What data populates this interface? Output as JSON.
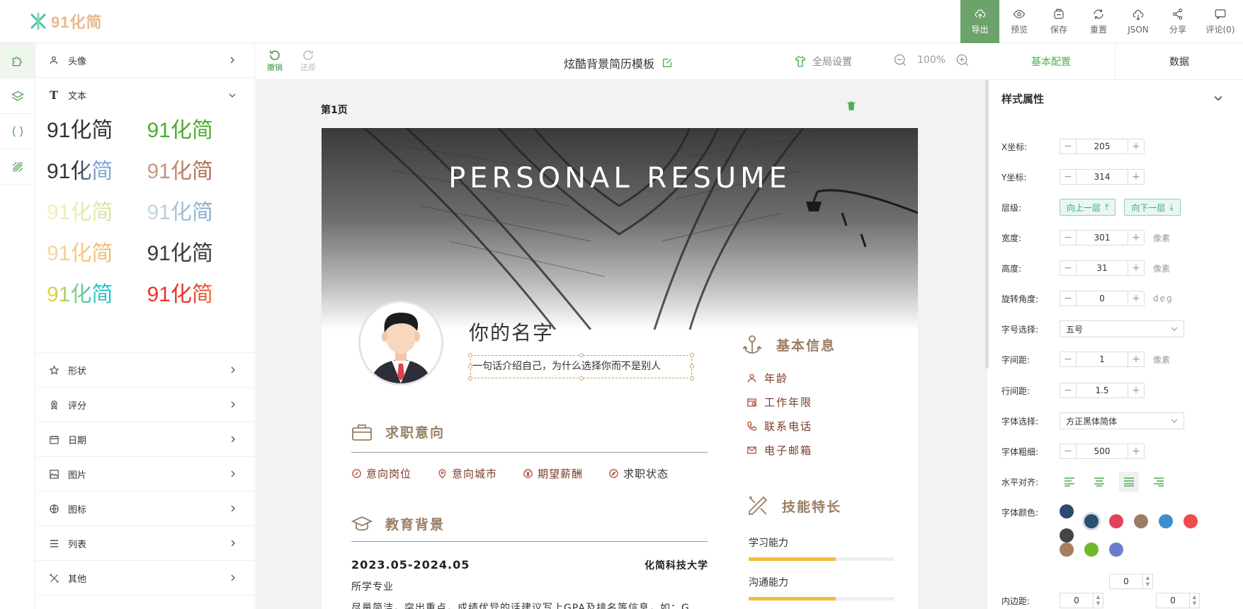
{
  "app": {
    "logo_text": "91化简"
  },
  "toolbar": [
    {
      "label": "导出",
      "icon": "cloud-upload-icon"
    },
    {
      "label": "预览",
      "icon": "eye-icon"
    },
    {
      "label": "保存",
      "icon": "save-icon"
    },
    {
      "label": "重置",
      "icon": "refresh-icon"
    },
    {
      "label": "JSON",
      "icon": "cloud-download-icon"
    },
    {
      "label": "分享",
      "icon": "share-icon"
    },
    {
      "label": "评论(0)",
      "icon": "comment-icon"
    }
  ],
  "left_panel": {
    "avatar": "头像",
    "text": "文本",
    "text_samples": [
      "91化简",
      "91化简",
      "91化简",
      "91化简",
      "91化简",
      "91化简",
      "91化简",
      "91化简",
      "91化简",
      "91化简"
    ],
    "items": [
      "形状",
      "评分",
      "日期",
      "图片",
      "图标",
      "列表",
      "其他"
    ]
  },
  "editor": {
    "undo": "撤销",
    "redo": "还原",
    "title": "炫酷背景简历模板",
    "global_settings": "全局设置",
    "zoom": "100%",
    "tab_basic": "基本配置",
    "tab_data": "数据",
    "page_label": "第1页"
  },
  "resume": {
    "hero_title": "PERSONAL RESUME",
    "name": "你的名字",
    "intro": "一句话介绍自己，为什么选择你而不是别人",
    "sec_intent": "求职意向",
    "intent_items": [
      "意向岗位",
      "意向城市",
      "期望薪酬",
      "求职状态"
    ],
    "sec_edu": "教育背景",
    "edu_date": "2023.05-2024.05",
    "edu_school": "化简科技大学",
    "edu_major": "所学专业",
    "edu_desc": "尽量简洁，突出重点，成绩优异的话建议写上GPA及排名等信息，如：G",
    "sec_basic": "基本信息",
    "basic_items": [
      "年龄",
      "工作年限",
      "联系电话",
      "电子邮箱"
    ],
    "sec_skills": "技能特长",
    "skills": [
      {
        "name": "学习能力",
        "level": 0.6
      },
      {
        "name": "沟通能力",
        "level": 0.6
      }
    ]
  },
  "style_panel": {
    "title": "样式属性",
    "x_label": "X坐标:",
    "x": "205",
    "y_label": "Y坐标:",
    "y": "314",
    "layer_label": "层级:",
    "layer_up": "向上一层",
    "layer_down": "向下一层",
    "width_label": "宽度:",
    "width": "301",
    "height_label": "高度:",
    "height": "31",
    "unit_px": "像素",
    "rotate_label": "旋转角度:",
    "rotate": "0",
    "unit_deg": "deg",
    "fontsize_label": "字号选择:",
    "fontsize": "五号",
    "spacing_label": "字间距:",
    "spacing": "1",
    "lineheight_label": "行间距:",
    "lineheight": "1.5",
    "font_label": "字体选择:",
    "font": "方正黑体简体",
    "weight_label": "字体粗细:",
    "weight": "500",
    "align_label": "水平对齐:",
    "color_label": "字体颜色:",
    "colors": [
      "#2c4a6e",
      "#2a4f72",
      "#e0445c",
      "#9a7e64",
      "#3f8fcf",
      "#ee4b4b",
      "#444444",
      "#a67f5d",
      "#6fba2c",
      "#6a7fcc"
    ],
    "padding_label": "内边距:",
    "pad_top": "0",
    "pad_left": "0",
    "pad_right": "0"
  }
}
